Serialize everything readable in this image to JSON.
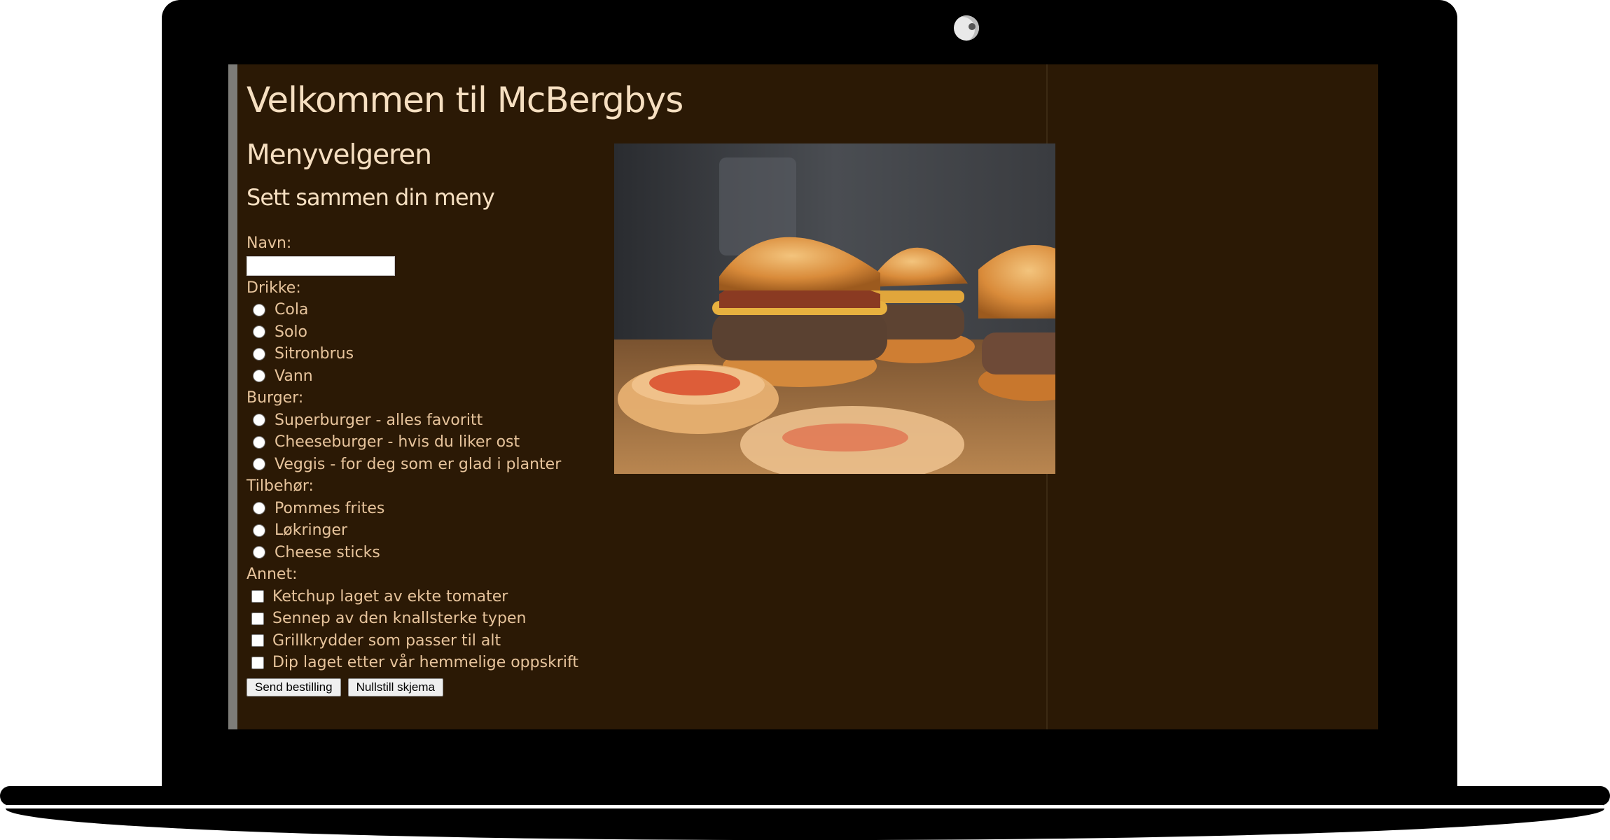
{
  "page": {
    "title": "Velkommen til McBergbys",
    "subtitle": "Menyvelgeren",
    "section_heading": "Sett sammen din meny"
  },
  "form": {
    "name": {
      "label": "Navn:",
      "value": "",
      "placeholder": ""
    },
    "drinks": {
      "label": "Drikke:",
      "options": [
        "Cola",
        "Solo",
        "Sitronbrus",
        "Vann"
      ]
    },
    "burger": {
      "label": "Burger:",
      "options": [
        "Superburger - alles favoritt",
        "Cheeseburger - hvis du liker ost",
        "Veggis - for deg som er glad i planter"
      ]
    },
    "sides": {
      "label": "Tilbehør:",
      "options": [
        "Pommes frites",
        "Løkringer",
        "Cheese sticks"
      ]
    },
    "extras": {
      "label": "Annet:",
      "options": [
        "Ketchup laget av ekte tomater",
        "Sennep av den knallsterke typen",
        "Grillkrydder som passer til alt",
        "Dip laget etter vår hemmelige oppskrift"
      ]
    },
    "submit_label": "Send bestilling",
    "reset_label": "Nullstill skjema"
  },
  "image": {
    "subject": "burgers-photo"
  },
  "colors": {
    "background": "#2b1905",
    "text": "#f3d9b8",
    "accent_bar": "#7d7c78"
  }
}
